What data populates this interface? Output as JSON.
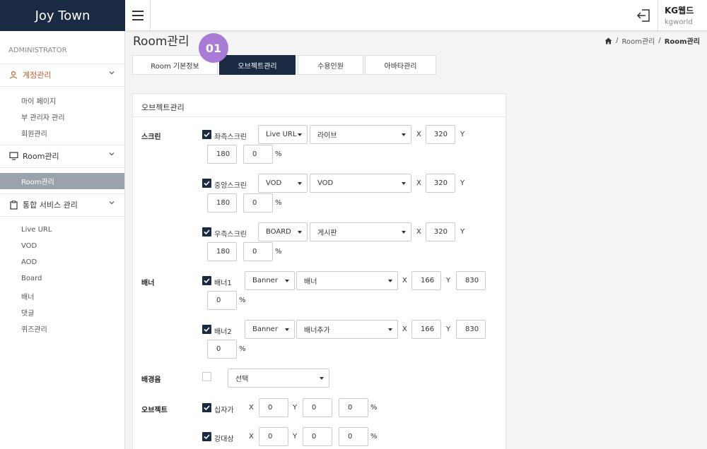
{
  "app": {
    "logo": "Joy Town"
  },
  "user": {
    "name": "KG웹드",
    "id": "kgworld"
  },
  "sidebar": {
    "section_label": "ADMINISTRATOR",
    "groups": [
      {
        "label": "계정관리",
        "items": [
          "마이 페이지",
          "부 관리자 관리",
          "회원관리"
        ]
      },
      {
        "label": "Room관리",
        "items": [
          "Room관리"
        ]
      },
      {
        "label": "통합 서비스 관리",
        "items": [
          "Live URL",
          "VOD",
          "AOD",
          "Board",
          "배너",
          "댓글",
          "퀴즈관리"
        ]
      }
    ]
  },
  "page": {
    "title": "Room관리",
    "step_badge": "01",
    "breadcrumb": {
      "first": "Room관리",
      "current": "Room관리"
    }
  },
  "tabs": [
    "Room 기본정보",
    "오브젝트관리",
    "수용인원",
    "아바타관리"
  ],
  "panel": {
    "title": "오브젝트관리",
    "screen": {
      "label": "스크린",
      "rows": [
        {
          "name": "좌측스크린",
          "type": "Live URL",
          "content": "라이브",
          "x_label": "X",
          "x": "320",
          "y_label": "Y",
          "y": "180",
          "z": "0",
          "unit": "%"
        },
        {
          "name": "중앙스크린",
          "type": "VOD",
          "content": "VOD",
          "x_label": "X",
          "x": "320",
          "y_label": "Y",
          "y": "180",
          "z": "0",
          "unit": "%"
        },
        {
          "name": "우측스크린",
          "type": "BOARD",
          "content": "게시판",
          "x_label": "X",
          "x": "320",
          "y_label": "Y",
          "y": "180",
          "z": "0",
          "unit": "%"
        }
      ]
    },
    "banner": {
      "label": "배너",
      "rows": [
        {
          "name": "배너1",
          "type": "Banner",
          "content": "배너",
          "x_label": "X",
          "x": "166",
          "y_label": "Y",
          "y": "830",
          "z": "0",
          "unit": "%"
        },
        {
          "name": "배너2",
          "type": "Banner",
          "content": "배너추가",
          "x_label": "X",
          "x": "166",
          "y_label": "Y",
          "y": "830",
          "z": "0",
          "unit": "%"
        }
      ]
    },
    "bgm": {
      "label": "배경음",
      "select": "선택"
    },
    "object": {
      "label": "오브젝트",
      "rows": [
        {
          "name": "십자가",
          "x_label": "X",
          "x": "0",
          "y_label": "Y",
          "y": "0",
          "z": "0",
          "unit": "%"
        },
        {
          "name": "강대상",
          "x_label": "X",
          "x": "0",
          "y_label": "Y",
          "y": "0",
          "z": "0",
          "unit": "%"
        }
      ]
    }
  },
  "colors": {
    "navy": "#1b2a43",
    "badge": "#a97bd6",
    "accent_orange": "#c0622f",
    "active_item": "#9aa3ac"
  },
  "icons": [
    "hamburger-icon",
    "logout-icon",
    "user-icon",
    "monitor-icon",
    "clipboard-icon",
    "chevron-down-icon",
    "home-icon",
    "check-icon"
  ]
}
